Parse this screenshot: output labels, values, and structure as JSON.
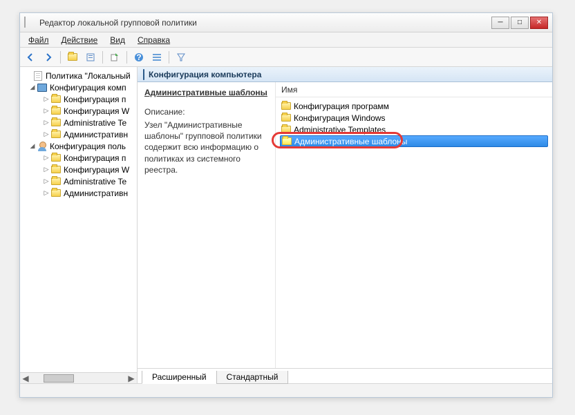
{
  "window": {
    "title": "Редактор локальной групповой политики"
  },
  "menubar": {
    "file": "Файл",
    "action": "Действие",
    "view": "Вид",
    "help": "Справка"
  },
  "tree": {
    "root": "Политика \"Локальный",
    "comp_config": "Конфигурация комп",
    "items_a": [
      "Конфигурация п",
      "Конфигурация W",
      "Administrative Te",
      "Административн"
    ],
    "user_config": "Конфигурация поль",
    "items_b": [
      "Конфигурация п",
      "Конфигурация W",
      "Administrative Te",
      "Административн"
    ]
  },
  "header": {
    "title": "Конфигурация компьютера"
  },
  "description": {
    "section_title": "Административные шаблоны",
    "label": "Описание:",
    "text": "Узел \"Административные шаблоны\" групповой политики содержит всю информацию о политиках из системного реестра."
  },
  "list": {
    "col_name": "Имя",
    "rows": [
      {
        "label": "Конфигурация программ",
        "selected": false
      },
      {
        "label": "Конфигурация Windows",
        "selected": false
      },
      {
        "label": "Administrative Templates",
        "selected": false
      },
      {
        "label": "Административные шаблоны",
        "selected": true
      }
    ]
  },
  "tabs": {
    "extended": "Расширенный",
    "standard": "Стандартный"
  }
}
